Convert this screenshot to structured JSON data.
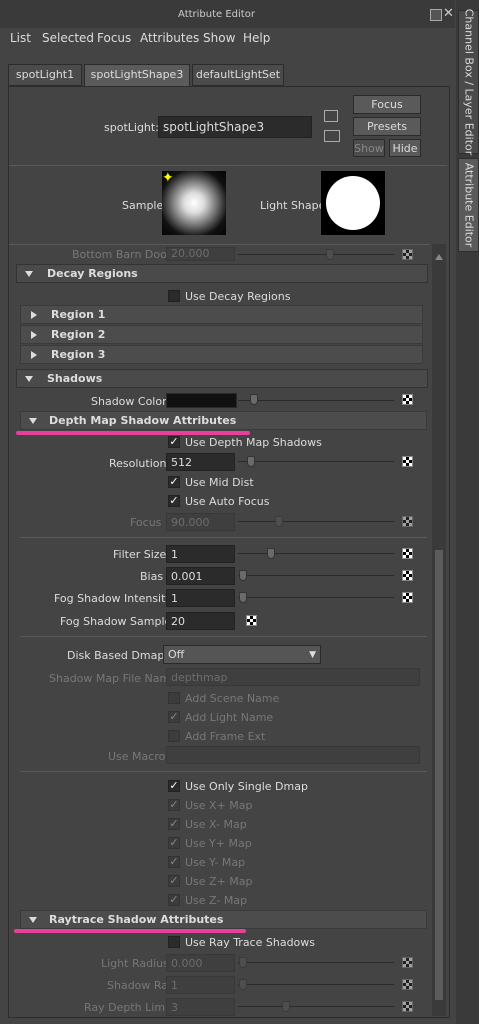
{
  "window": {
    "title": "Attribute Editor"
  },
  "side_tabs": [
    "Channel Box / Layer Editor",
    "Attribute Editor"
  ],
  "menu": [
    "List",
    "Selected",
    "Focus",
    "Attributes",
    "Show",
    "Help"
  ],
  "tabs": [
    "spotLight1",
    "spotLightShape3",
    "defaultLightSet"
  ],
  "node": {
    "type_label": "spotLight:",
    "name": "spotLightShape3"
  },
  "buttons": {
    "focus": "Focus",
    "presets": "Presets",
    "show": "Show",
    "hide": "Hide"
  },
  "swatches": {
    "sample": "Sample",
    "light_shape": "Light Shape"
  },
  "bottom_barn_door": {
    "label": "Bottom Barn Door",
    "value": "20.000"
  },
  "decay": {
    "title": "Decay Regions",
    "use_decay": "Use Decay Regions",
    "regions": [
      "Region 1",
      "Region 2",
      "Region 3"
    ]
  },
  "shadows": {
    "title": "Shadows",
    "shadow_color_label": "Shadow Color"
  },
  "depth_map": {
    "title": "Depth Map Shadow Attributes",
    "use_depth": "Use Depth Map Shadows",
    "resolution": {
      "label": "Resolution",
      "value": "512"
    },
    "use_mid_dist": "Use Mid Dist",
    "use_auto_focus": "Use Auto Focus",
    "focus": {
      "label": "Focus",
      "value": "90.000"
    },
    "filter_size": {
      "label": "Filter Size",
      "value": "1"
    },
    "bias": {
      "label": "Bias",
      "value": "0.001"
    },
    "fog_intensity": {
      "label": "Fog Shadow Intensity",
      "value": "1"
    },
    "fog_samples": {
      "label": "Fog Shadow Samples",
      "value": "20"
    },
    "disk_dmaps": {
      "label": "Disk Based Dmaps",
      "value": "Off"
    },
    "file_name": {
      "label": "Shadow Map File Name",
      "value": "depthmap"
    },
    "add_scene_name": "Add Scene Name",
    "add_light_name": "Add Light Name",
    "add_frame_ext": "Add Frame Ext",
    "use_macro": "Use Macro",
    "use_only_single": "Use Only Single Dmap",
    "maps": [
      "Use X+ Map",
      "Use X- Map",
      "Use Y+ Map",
      "Use Y- Map",
      "Use Z+ Map",
      "Use Z- Map"
    ]
  },
  "raytrace": {
    "title": "Raytrace Shadow Attributes",
    "use_raytrace": "Use Ray Trace Shadows",
    "light_radius": {
      "label": "Light Radius",
      "value": "0.000"
    },
    "shadow_rays": {
      "label": "Shadow Rays",
      "value": "1"
    },
    "ray_depth": {
      "label": "Ray Depth Limit",
      "value": "3"
    }
  },
  "colors": {
    "highlight": "#e8409a",
    "panel": "#444444"
  }
}
